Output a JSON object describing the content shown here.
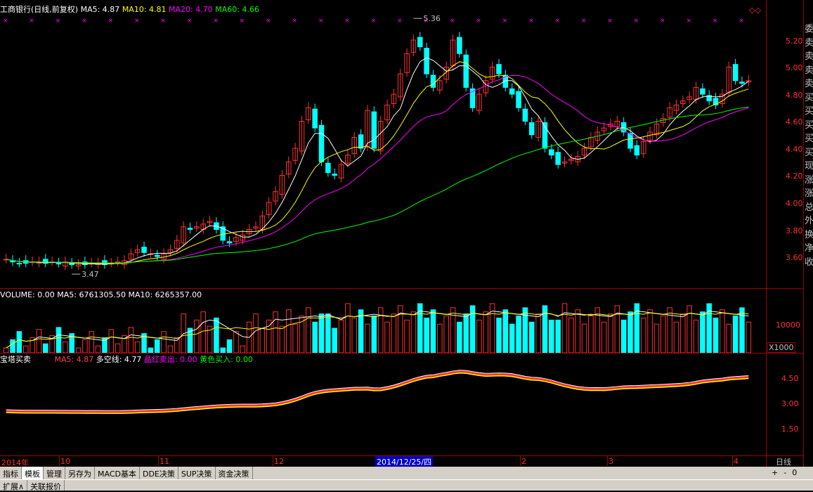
{
  "main_header": {
    "title": "工商银行(日线,前复权)",
    "ma5": "MA5: 4.87",
    "ma10": "MA10: 4.81",
    "ma20": "MA20: 4.70",
    "ma60": "MA60: 4.66"
  },
  "price_axis": [
    "5.20",
    "5.00",
    "4.80",
    "4.60",
    "4.40",
    "4.20",
    "4.00",
    "3.80",
    "3.60"
  ],
  "price_annotations": {
    "high": "5.36",
    "low": "3.47"
  },
  "volume_header": {
    "volume": "VOLUME: 0.00",
    "ma5": "MA5: 6761305.50",
    "ma10": "MA10: 6265357.00"
  },
  "volume_axis": {
    "tick": "10000",
    "unit": "X1000"
  },
  "indicator_header": {
    "name": "宝塔买卖",
    "ma5": "MA5: 4.87",
    "duokong": "多空线: 4.77",
    "red_sell": "晶红卖出: 0.00",
    "yellow_buy": "黄色买入: 0.00"
  },
  "indicator_axis": [
    "4.50",
    "3.00",
    "1.50"
  ],
  "date_axis": {
    "year": "2014年",
    "months": [
      "10",
      "11",
      "12",
      "2",
      "3",
      "4"
    ],
    "cursor_date": "2014/12/25/四",
    "period": "日线"
  },
  "side_panel": [
    "委",
    "卖",
    "卖",
    "卖",
    "卖",
    "买",
    "买",
    "买",
    "买",
    "买",
    "现",
    "涨",
    "涨",
    "总",
    "外",
    "换",
    "净",
    "收"
  ],
  "tabs": [
    "指标",
    "模板",
    "管理",
    "另存为",
    "MACD基本",
    "DDE决策",
    "SUP决策",
    "资金决策"
  ],
  "status": {
    "expand": "扩展∧",
    "quote": "关联报价",
    "plus": "+",
    "minus": "-",
    "zero": "0"
  },
  "colors": {
    "up": "#ff3030",
    "down": "#00ffff",
    "ma5": "#ffffff",
    "ma10": "#ffff00",
    "ma20": "#ff00ff",
    "ma60": "#00ff00"
  },
  "chart_data": {
    "type": "candlestick",
    "note_series": "approximate daily closes read from the price pane",
    "closes": [
      3.58,
      3.56,
      3.55,
      3.55,
      3.56,
      3.56,
      3.55,
      3.56,
      3.55,
      3.56,
      3.54,
      3.54,
      3.54,
      3.55,
      3.55,
      3.54,
      3.55,
      3.56,
      3.57,
      3.62,
      3.65,
      3.63,
      3.62,
      3.6,
      3.62,
      3.65,
      3.72,
      3.82,
      3.8,
      3.82,
      3.84,
      3.86,
      3.8,
      3.72,
      3.7,
      3.74,
      3.76,
      3.8,
      3.82,
      3.9,
      4.0,
      4.08,
      4.2,
      4.3,
      4.4,
      4.6,
      4.7,
      4.55,
      4.3,
      4.22,
      4.2,
      4.28,
      4.35,
      4.48,
      4.4,
      4.68,
      4.4,
      4.6,
      4.72,
      4.8,
      4.95,
      5.1,
      5.2,
      5.15,
      4.95,
      4.85,
      4.9,
      5.0,
      5.2,
      5.1,
      4.85,
      4.7,
      4.8,
      4.9,
      5.0,
      4.95,
      4.85,
      4.8,
      4.7,
      4.6,
      4.5,
      4.6,
      4.4,
      4.35,
      4.28,
      4.3,
      4.32,
      4.34,
      4.4,
      4.48,
      4.52,
      4.55,
      4.58,
      4.6,
      4.52,
      4.4,
      4.35,
      4.45,
      4.52,
      4.58,
      4.62,
      4.7,
      4.72,
      4.75,
      4.78,
      4.85,
      4.8,
      4.75,
      4.72,
      4.8,
      5.0,
      4.9,
      4.88,
      4.9
    ]
  }
}
